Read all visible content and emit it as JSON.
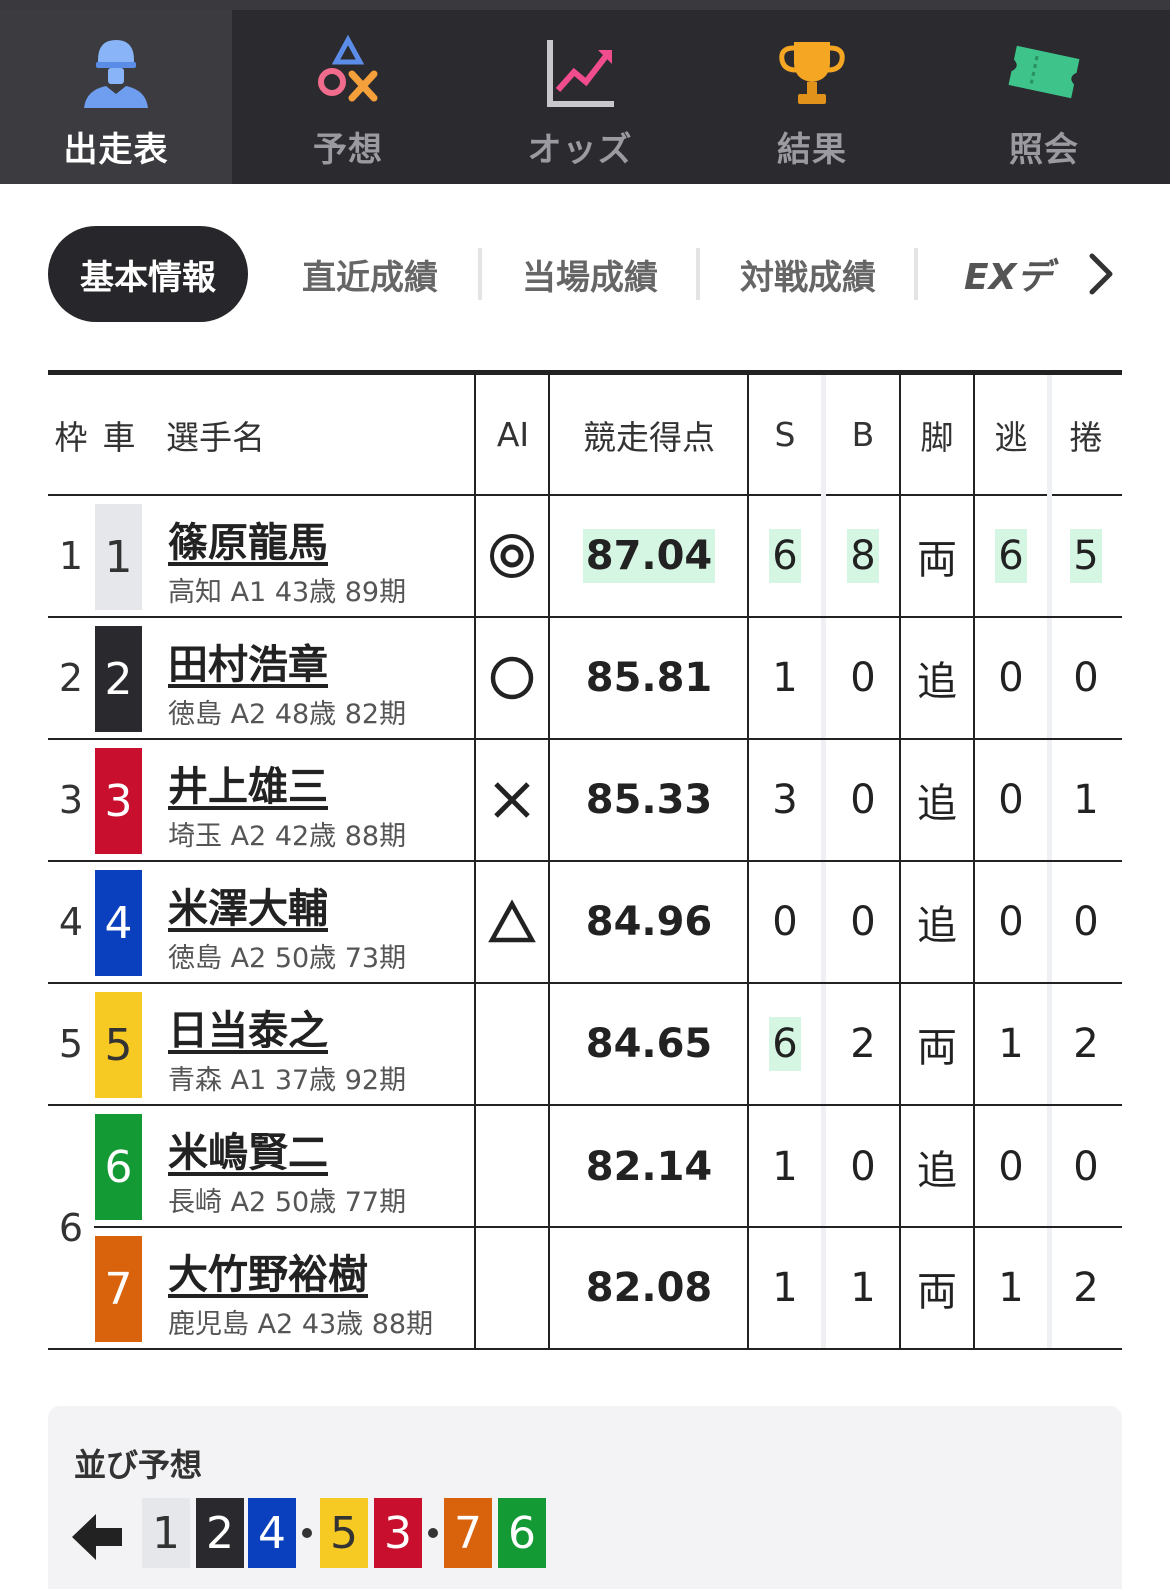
{
  "nav": {
    "tabs": [
      {
        "label": "出走表",
        "icon": "racer-helmet-icon",
        "active": true
      },
      {
        "label": "予想",
        "icon": "prediction-marks-icon",
        "active": false
      },
      {
        "label": "オッズ",
        "icon": "odds-chart-icon",
        "active": false
      },
      {
        "label": "結果",
        "icon": "trophy-icon",
        "active": false
      },
      {
        "label": "照会",
        "icon": "ticket-icon",
        "active": false
      }
    ]
  },
  "subtabs": [
    {
      "label": "基本情報",
      "active": true
    },
    {
      "label": "直近成績",
      "active": false
    },
    {
      "label": "当場成績",
      "active": false
    },
    {
      "label": "対戦成績",
      "active": false
    },
    {
      "label": "EXデ",
      "active": false
    }
  ],
  "table": {
    "headers": {
      "waku": "枠",
      "sha": "車",
      "name": "選手名",
      "ai": "AI",
      "score": "競走得点",
      "s": "S",
      "b": "B",
      "kyaku": "脚",
      "nige": "逃",
      "makuri": "捲"
    },
    "rows": [
      {
        "waku": "1",
        "sha": "1",
        "name": "篠原龍馬",
        "info": "高知 A1 43歳 89期",
        "ai": "◎",
        "score": "87.04",
        "s": "6",
        "b": "8",
        "kyaku": "両",
        "nige": "6",
        "makuri": "5"
      },
      {
        "waku": "2",
        "sha": "2",
        "name": "田村浩章",
        "info": "徳島 A2 48歳 82期",
        "ai": "○",
        "score": "85.81",
        "s": "1",
        "b": "0",
        "kyaku": "追",
        "nige": "0",
        "makuri": "0"
      },
      {
        "waku": "3",
        "sha": "3",
        "name": "井上雄三",
        "info": "埼玉 A2 42歳 88期",
        "ai": "×",
        "score": "85.33",
        "s": "3",
        "b": "0",
        "kyaku": "追",
        "nige": "0",
        "makuri": "1"
      },
      {
        "waku": "4",
        "sha": "4",
        "name": "米澤大輔",
        "info": "徳島 A2 50歳 73期",
        "ai": "△",
        "score": "84.96",
        "s": "0",
        "b": "0",
        "kyaku": "追",
        "nige": "0",
        "makuri": "0"
      },
      {
        "waku": "5",
        "sha": "5",
        "name": "日当泰之",
        "info": "青森 A1 37歳 92期",
        "ai": "",
        "score": "84.65",
        "s": "6",
        "b": "2",
        "kyaku": "両",
        "nige": "1",
        "makuri": "2"
      },
      {
        "waku": "6",
        "sha": "6",
        "name": "米嶋賢二",
        "info": "長崎 A2 50歳 77期",
        "ai": "",
        "score": "82.14",
        "s": "1",
        "b": "0",
        "kyaku": "追",
        "nige": "0",
        "makuri": "0"
      },
      {
        "waku": "",
        "sha": "7",
        "name": "大竹野裕樹",
        "info": "鹿児島 A2 43歳 88期",
        "ai": "",
        "score": "82.08",
        "s": "1",
        "b": "1",
        "kyaku": "両",
        "nige": "1",
        "makuri": "2"
      }
    ]
  },
  "narabi": {
    "title": "並び予想",
    "groups": [
      "1",
      "2",
      "4",
      "5",
      "3",
      "7",
      "6"
    ]
  },
  "colors": {
    "c1": "#e6e7ea",
    "c2": "#2a2a2e",
    "c3": "#c8102e",
    "c4": "#0a3fbd",
    "c5": "#f7c923",
    "c6": "#139a35",
    "c7": "#d9620c",
    "highlight": "#d6f6e4"
  }
}
